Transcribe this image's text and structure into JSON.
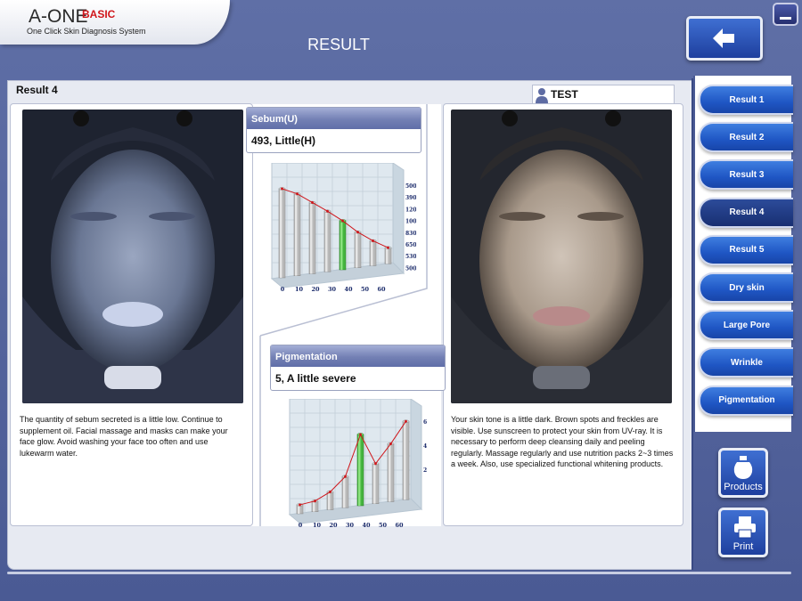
{
  "app": {
    "logo": "A-ONE",
    "logo_edition": "BASIC",
    "subtitle": "One Click Skin Diagnosis System",
    "page_title": "RESULT"
  },
  "panel": {
    "title": "Result 4",
    "user_name": "TEST"
  },
  "sebum": {
    "label": "Sebum(U)",
    "value": "493,  Little(H)",
    "description": "The quantity of sebum secreted is a little low. Continue to supplement oil. Facial massage and masks can make your face glow. Avoid washing your face too often and use lukewarm water.",
    "chart_data": {
      "type": "bar",
      "categories": [
        "0",
        "10",
        "20",
        "30",
        "40",
        "50",
        "60"
      ],
      "values": [
        1.0,
        0.92,
        0.8,
        0.68,
        0.55,
        0.4,
        0.28,
        0.18
      ],
      "x": [
        0,
        1,
        2,
        3,
        4,
        5,
        6,
        7
      ],
      "highlight_index": 4,
      "y_ticks": [
        "5000",
        "3900",
        "1200",
        "1000",
        "830",
        "650",
        "530",
        "500"
      ],
      "trend_line": true
    }
  },
  "pigmentation": {
    "label": "Pigmentation",
    "value": "5,  A little severe",
    "description": "Your skin tone is a little dark. Brown spots and freckles are visible. Use sunscreen to protect your skin from UV-ray. It is necessary to perform deep cleansing daily and peeling regularly. Massage regularly and use nutrition packs 2~3 times a week. Also, use specialized functional whitening products.",
    "chart_data": {
      "type": "bar",
      "categories": [
        "0",
        "10",
        "20",
        "30",
        "40",
        "50",
        "60"
      ],
      "values": [
        0.1,
        0.12,
        0.2,
        0.35,
        0.8,
        0.45,
        0.65,
        0.88
      ],
      "x": [
        0,
        1,
        2,
        3,
        4,
        5,
        6,
        7
      ],
      "highlight_index": 4,
      "y_ticks": [
        "6",
        "4",
        "2"
      ],
      "trend_line": true
    }
  },
  "sidebar": {
    "items": [
      {
        "label": "Result 1",
        "active": false
      },
      {
        "label": "Result 2",
        "active": false
      },
      {
        "label": "Result 3",
        "active": false
      },
      {
        "label": "Result 4",
        "active": true
      },
      {
        "label": "Result 5",
        "active": false
      },
      {
        "label": "Dry skin",
        "active": false
      },
      {
        "label": "Large Pore",
        "active": false
      },
      {
        "label": "Wrinkle",
        "active": false
      },
      {
        "label": "Pigmentation",
        "active": false
      }
    ]
  },
  "actions": {
    "products_label": "Products",
    "print_label": "Print"
  },
  "colors": {
    "background": "#5566a0",
    "panel": "#e7eaf2",
    "button_blue": "#1f56c4",
    "header_bar": "#7380b4",
    "bar_gray": "#b8b8b8",
    "bar_highlight": "#45b53f",
    "trend_line": "#d0161b",
    "brand_red": "#d0161b"
  },
  "icons": {
    "back": "arrow-left-icon",
    "minimize": "minimize-icon",
    "user": "user-icon",
    "products": "bottle-icon",
    "print": "printer-icon"
  }
}
